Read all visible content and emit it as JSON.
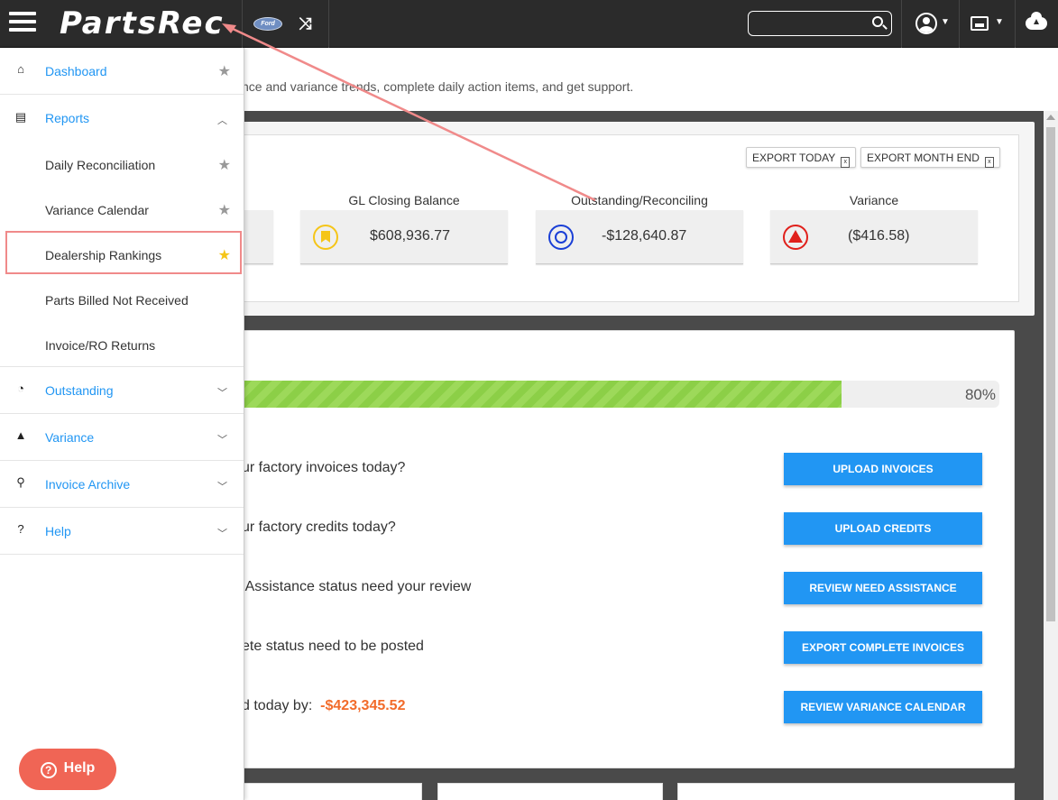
{
  "app": {
    "logo": "PartsRec",
    "search": {
      "value": "",
      "placeholder": ""
    }
  },
  "page": {
    "subtitle": "nce and variance trends, complete daily action items, and get support."
  },
  "exports": {
    "today": "EXPORT TODAY",
    "month_end": "EXPORT MONTH END"
  },
  "stats": [
    {
      "label": "GL Closing Balance",
      "value": "$608,936.77",
      "icon": "bookmark-icon",
      "color": "#f5c518"
    },
    {
      "label": "Outstanding/Reconciling",
      "value": "-$128,640.87",
      "icon": "dashboard-icon",
      "color": "#1a3fd6"
    },
    {
      "label": "Variance",
      "value": "($416.58)",
      "icon": "warning-icon",
      "color": "#e0201b"
    }
  ],
  "progress": {
    "value": 0.8,
    "label": "80%"
  },
  "tasks": [
    {
      "text": "ur factory invoices today?",
      "amount": "",
      "button": "UPLOAD INVOICES"
    },
    {
      "text": "ur factory credits today?",
      "amount": "",
      "button": "UPLOAD CREDITS"
    },
    {
      "text": " Assistance status need your review",
      "amount": "",
      "button": "REVIEW NEED ASSISTANCE"
    },
    {
      "text": "ete status need to be posted",
      "amount": "",
      "button": "EXPORT COMPLETE INVOICES"
    },
    {
      "text": "d today by:",
      "amount": "-$423,345.52",
      "button": "REVIEW VARIANCE CALENDAR"
    }
  ],
  "sidebar": {
    "dashboard": "Dashboard",
    "reports": "Reports",
    "reports_items": [
      "Daily Reconciliation",
      "Variance Calendar",
      "Dealership Rankings",
      "Parts Billed Not Received",
      "Invoice/RO Returns"
    ],
    "outstanding": "Outstanding",
    "variance": "Variance",
    "invoice_archive": "Invoice Archive",
    "help": "Help"
  },
  "help_button": "Help",
  "colors": {
    "accent": "#2196f3",
    "topbar": "#2b2b2b",
    "progress": "#8ccf47",
    "amount": "#f26b2a",
    "help": "#f06555",
    "annotation": "#f08a8a"
  }
}
